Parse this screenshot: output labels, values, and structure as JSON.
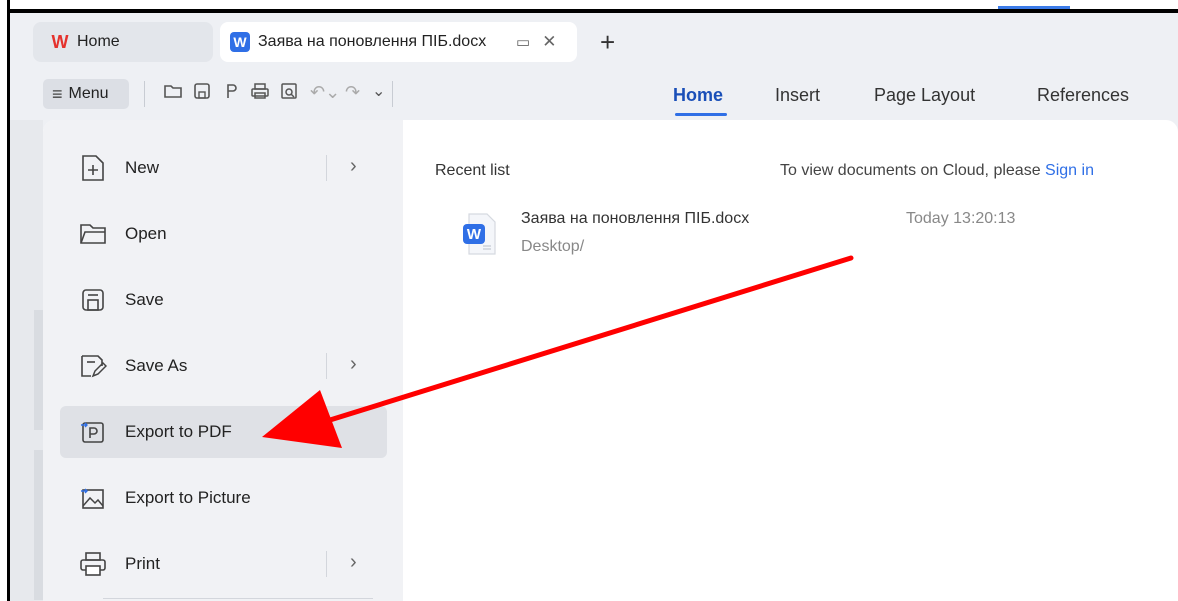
{
  "tabs": {
    "home_label": "Home",
    "doc_label": "Заява на поновлення ПІБ.docx",
    "add_symbol": "+"
  },
  "toolbar": {
    "menu_label": "Menu"
  },
  "ribbon": {
    "tabs": [
      "Home",
      "Insert",
      "Page Layout",
      "References"
    ]
  },
  "menu": {
    "items": [
      {
        "label": "New",
        "icon": "new-doc-icon",
        "submenu": true
      },
      {
        "label": "Open",
        "icon": "folder-open-icon",
        "submenu": false
      },
      {
        "label": "Save",
        "icon": "save-icon",
        "submenu": false
      },
      {
        "label": "Save As",
        "icon": "save-as-icon",
        "submenu": true
      },
      {
        "label": "Export to PDF",
        "icon": "export-pdf-icon",
        "submenu": false
      },
      {
        "label": "Export to Picture",
        "icon": "export-picture-icon",
        "submenu": false
      },
      {
        "label": "Print",
        "icon": "print-icon",
        "submenu": true
      }
    ]
  },
  "recent": {
    "title": "Recent list",
    "cloud_prefix": "To view documents on Cloud, please ",
    "cloud_link": "Sign in",
    "files": [
      {
        "name": "Заява на поновлення ПІБ.docx",
        "path": "Desktop/",
        "time": "Today 13:20:13"
      }
    ]
  },
  "colors": {
    "accent": "#2f6fe6",
    "annotation_arrow": "#ff0000"
  }
}
